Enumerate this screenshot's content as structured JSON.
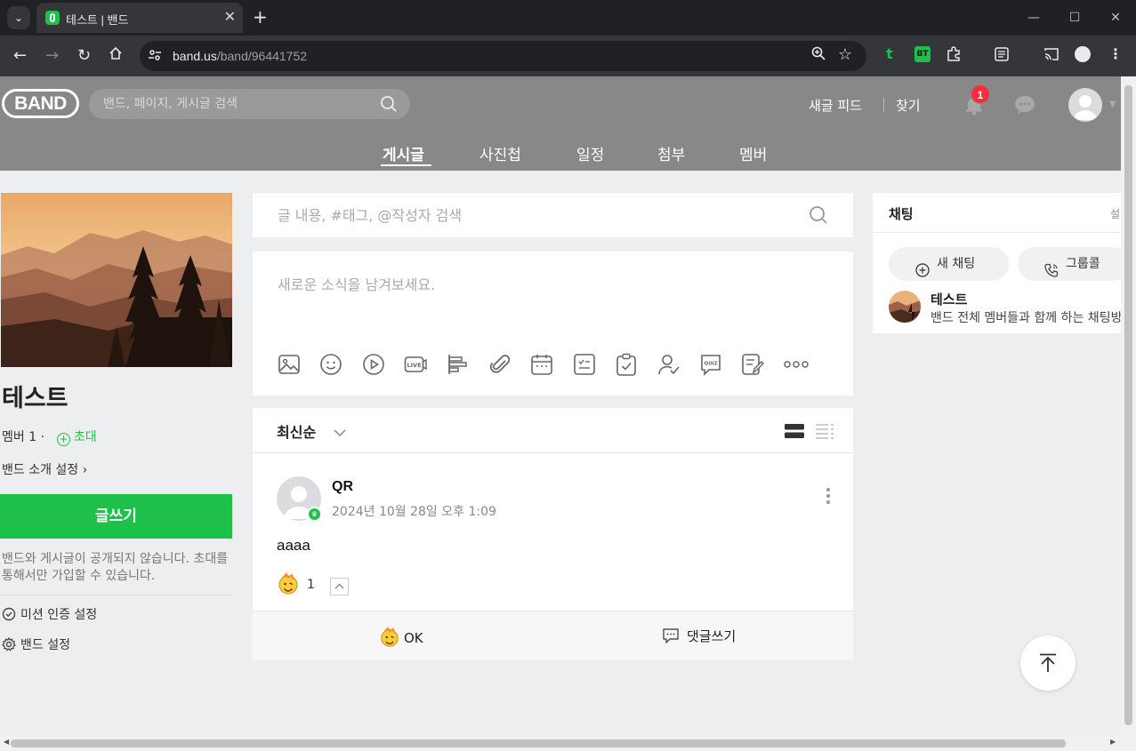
{
  "browser": {
    "tab_title": "테스트 | 밴드",
    "tab_close": "✕",
    "new_tab": "+",
    "url_host": "band.us",
    "url_path": "/band/96441752",
    "window_controls": [
      "—",
      "☐",
      "✕"
    ]
  },
  "header": {
    "logo": "BAND",
    "search_placeholder": "밴드, 페이지, 게시글 검색",
    "new_feed": "새글 피드",
    "find": "찾기",
    "notification_count": "1"
  },
  "subnav": {
    "items": [
      "게시글",
      "사진첩",
      "일정",
      "첨부",
      "멤버"
    ],
    "active": "게시글"
  },
  "band": {
    "name": "테스트",
    "members": "멤버 1 ·",
    "invite": "초대",
    "intro_setting": "밴드 소개 설정 ›",
    "write_button": "글쓰기",
    "privacy_note": "밴드와 게시글이 공개되지 않습니다. 초대를 통해서만 가입할 수 있습니다.",
    "mission_setting": "미션 인증 설정",
    "band_setting": "밴드 설정"
  },
  "feed": {
    "search_placeholder": "글 내용, #태그, @작성자 검색",
    "compose_placeholder": "새로운 소식을 남겨보세요.",
    "tool_icons": [
      "photo-icon",
      "emoji-icon",
      "video-icon",
      "live-icon",
      "poll-icon",
      "attachment-icon",
      "calendar-icon",
      "checklist-icon",
      "todo-icon",
      "attendance-icon",
      "quiz-icon",
      "form-icon",
      "more-icon"
    ],
    "sort_label": "최신순",
    "post": {
      "author": "QR",
      "date": "2024년 10월 28일 오후 1:09",
      "body": "aaaa",
      "reaction_count": "1",
      "ok_label": "OK",
      "comment_label": "댓글쓰기"
    }
  },
  "chat": {
    "title": "채팅",
    "setting": "설정",
    "new_chat": "새 채팅",
    "group_call": "그룹콜",
    "room_name": "테스트",
    "room_desc": "밴드 전체 멤버들과 함께 하는 채팅방"
  },
  "colors": {
    "accent": "#1ec04a",
    "header_bg": "#888888",
    "page_bg": "#eceef0",
    "badge": "#ff2d3b"
  }
}
